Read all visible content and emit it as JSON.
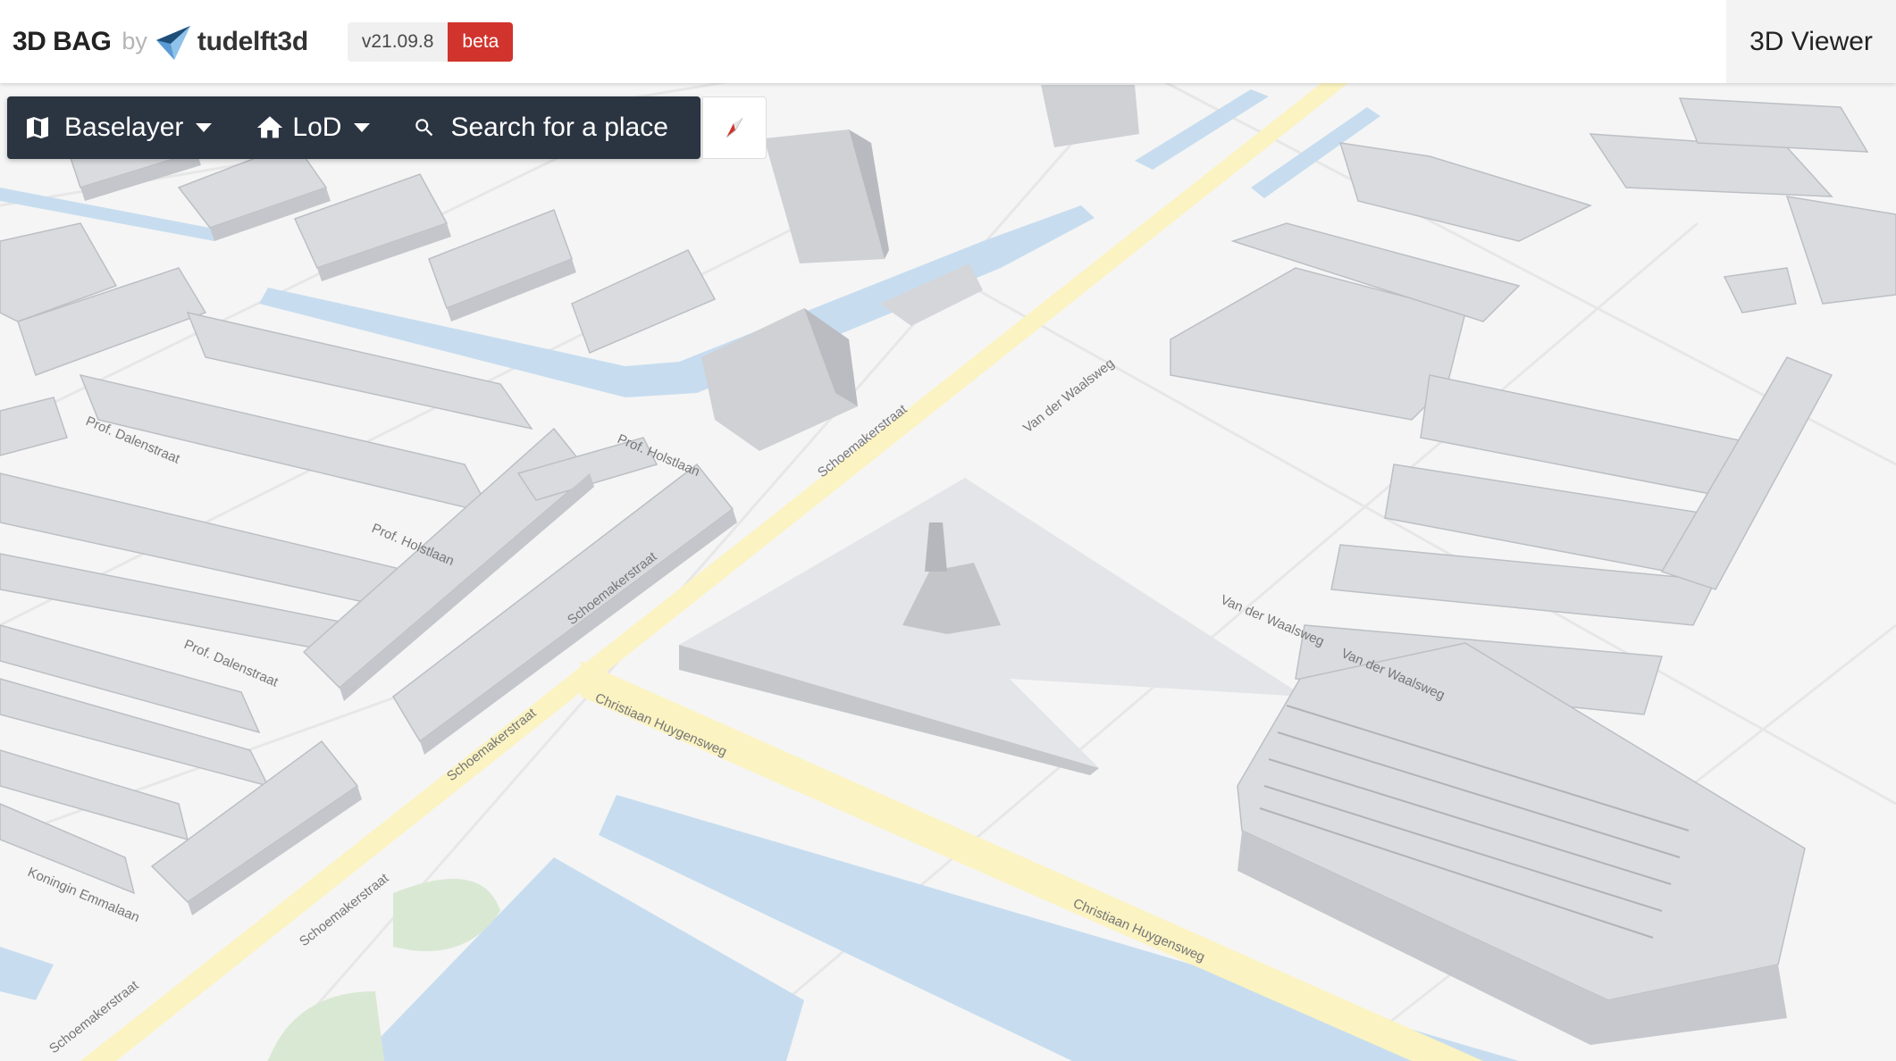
{
  "brand": {
    "name": "3D BAG",
    "by": "by",
    "org": "tudelft3d"
  },
  "version": {
    "number": "v21.09.8",
    "stage": "beta"
  },
  "nav": {
    "viewer_link": "3D Viewer"
  },
  "toolbar": {
    "baselayer_label": "Baselayer",
    "lod_label": "LoD",
    "search_label": "Search for a place"
  },
  "map": {
    "streets": [
      "Christiaan Huygensweg",
      "Christiaan Huygensweg",
      "Schoemakerstraat",
      "Schoemakerstraat",
      "Schoemakerstraat",
      "Schoemakerstraat",
      "Schoemakerstraat",
      "Van der Waalsweg",
      "Van der Waalsweg",
      "Van der Waalsweg",
      "Prof. Dalenstraat",
      "Prof. Dalenstraat",
      "Prof. Holstlaan",
      "Prof. Holstlaan",
      "Koningin Emmalaan"
    ]
  },
  "icons": [
    "baselayer-map-icon",
    "lod-home-icon",
    "search-icon",
    "compass-icon",
    "tudelft3d-logo"
  ],
  "colors": {
    "toolbar_bg": "#2b3441",
    "beta_badge": "#d0342c",
    "road_major": "#fbf3c2",
    "water": "#c7ddef",
    "building": "#d9dbdf"
  }
}
